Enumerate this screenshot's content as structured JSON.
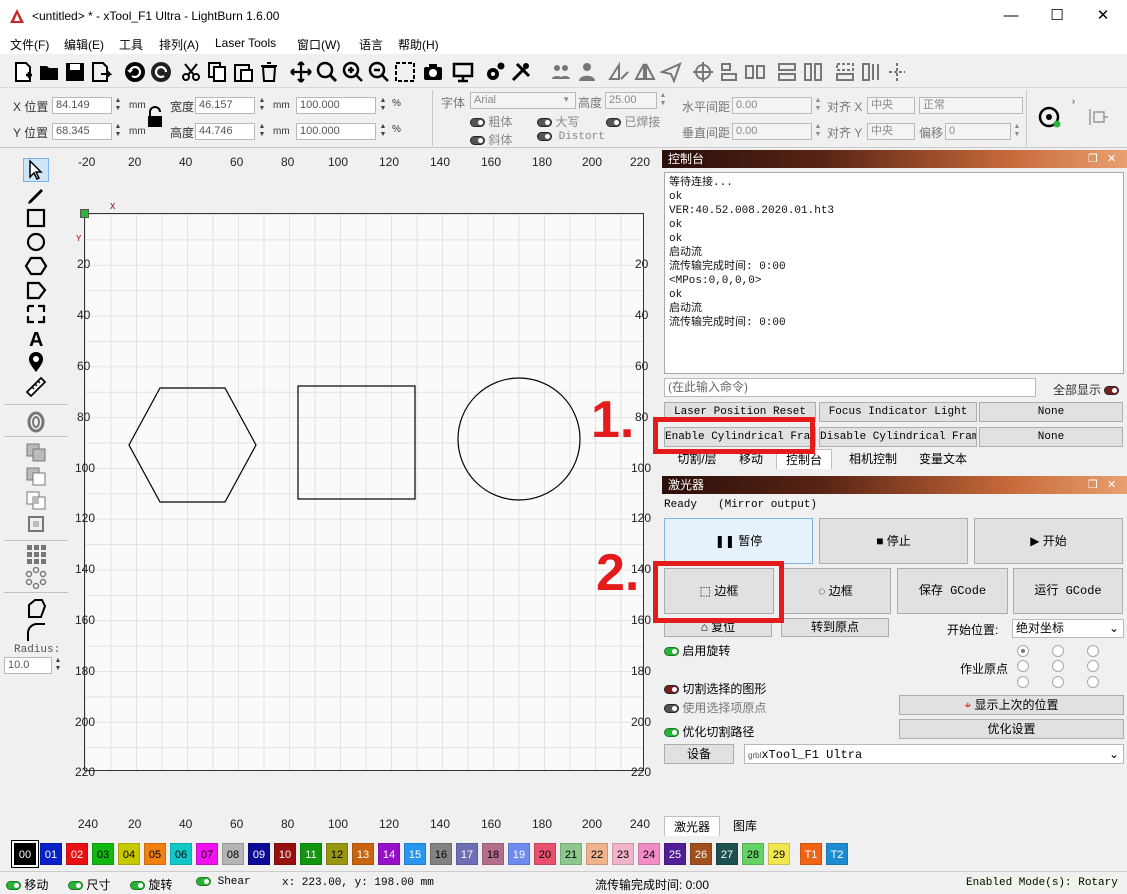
{
  "window": {
    "title": "<untitled> * - xTool_F1 Ultra - LightBurn 1.6.00",
    "minimize": "—",
    "maximize": "☐",
    "close": "✕"
  },
  "menu": [
    "文件(F)",
    "编辑(E)",
    "工具",
    "排列(A)",
    "Laser Tools",
    "窗口(W)",
    "语言",
    "帮助(H)"
  ],
  "props": {
    "x_label": "X 位置",
    "x_value": "84.149",
    "y_label": "Y 位置",
    "y_value": "68.345",
    "unit": "mm",
    "w_label": "宽度",
    "w_value": "46.157",
    "h_label": "高度",
    "h_value": "44.746",
    "pw_value": "100.000",
    "ph_value": "100.000",
    "pct": "%",
    "font_label": "字体",
    "font_value": "Arial",
    "height_label": "高度",
    "height_value": "25.00",
    "bold": "粗体",
    "upper": "大写",
    "welded": "已焊接",
    "italic": "斜体",
    "distort": "Distort",
    "hspace_label": "水平间距",
    "hspace_value": "0.00",
    "vspace_label": "垂直间距",
    "vspace_value": "0.00",
    "alignx_label": "对齐 X",
    "alignx_value": "中央",
    "aligny_label": "对齐 Y",
    "aligny_value": "中央",
    "normal_value": "正常",
    "offset_label": "偏移",
    "offset_value": "0"
  },
  "left": {
    "radius_label": "Radius:",
    "radius_value": "10.0"
  },
  "ruler": {
    "top": [
      "-20",
      "20",
      "40",
      "60",
      "80",
      "100",
      "120",
      "140",
      "160",
      "180",
      "200",
      "220"
    ],
    "side": [
      "20",
      "40",
      "60",
      "80",
      "100",
      "120",
      "140",
      "160",
      "180",
      "200",
      "220"
    ],
    "bottom": [
      "240",
      "20",
      "40",
      "60",
      "80",
      "100",
      "120",
      "140",
      "160",
      "180",
      "200",
      "240"
    ],
    "x_mark": "X",
    "y_mark": "Y"
  },
  "console": {
    "title": "控制台",
    "lines": [
      "等待连接...",
      "ok",
      "VER:40.52.008.2020.01.ht3",
      "ok",
      "ok",
      "启动流",
      "流传输完成时间: 0:00",
      "<MPos:0,0,0,0>",
      "ok",
      "",
      "启动流",
      "流传输完成时间: 0:00"
    ],
    "placeholder": "(在此输入命令)",
    "show_all": "全部显示",
    "macro1": "Laser Position Reset",
    "macro2": "Focus Indicator Light",
    "macro3": "None",
    "macro4": "Enable Cylindrical Frame",
    "macro5": "Disable Cylindrical Frame",
    "macro6": "None",
    "tabs": [
      "切割/层",
      "移动",
      "控制台",
      "相机控制",
      "变量文本"
    ]
  },
  "laser": {
    "title": "激光器",
    "status": "Ready",
    "mirror": "(Mirror output)",
    "pause": "暂停",
    "stop": "停止",
    "start": "开始",
    "frame1": "边框",
    "frame2": "边框",
    "save_gcode": "保存 GCode",
    "run_gcode": "运行 GCode",
    "home": "复位",
    "goto_origin": "转到原点",
    "start_from_label": "开始位置:",
    "start_from_value": "绝对坐标",
    "rotary": "启用旋转",
    "job_origin": "作业原点",
    "cut_selected": "切割选择的图形",
    "use_sel_origin": "使用选择项原点",
    "show_last": "显示上次的位置",
    "optimize": "优化切割路径",
    "opt_settings": "优化设置",
    "device_label": "设备",
    "device_value": "xTool_F1 Ultra",
    "grbl": "grbl",
    "bottom_tabs": [
      "激光器",
      "图库"
    ]
  },
  "annotations": {
    "n1": "1.",
    "n2": "2."
  },
  "palette": [
    "00",
    "01",
    "02",
    "03",
    "04",
    "05",
    "06",
    "07",
    "08",
    "09",
    "10",
    "11",
    "12",
    "13",
    "14",
    "15",
    "16",
    "17",
    "18",
    "19",
    "20",
    "21",
    "22",
    "23",
    "24",
    "25",
    "26",
    "27",
    "28",
    "29",
    "T1",
    "T2"
  ],
  "palette_colors": [
    "#000000",
    "#0a20c8",
    "#e81010",
    "#10b810",
    "#c8c800",
    "#f08010",
    "#10c8c8",
    "#f010f0",
    "#b4b4b4",
    "#0a0a96",
    "#961010",
    "#109610",
    "#969610",
    "#c86410",
    "#9610c8",
    "#2896f0",
    "#828282",
    "#6e6eb4",
    "#b46e8c",
    "#6e8cf0",
    "#e8506e",
    "#8cc88c",
    "#f0b48c",
    "#f0b4c8",
    "#f08cc8",
    "#501e96",
    "#a0501e",
    "#1e5050",
    "#64d264",
    "#f0e650",
    "#f06414",
    "#1e8cd2"
  ],
  "status": {
    "move": "移动",
    "size": "尺寸",
    "rotate": "旋转",
    "shear": "Shear",
    "coords": "x: 223.00, y: 198.00 mm",
    "stream": "流传输完成时间: 0:00",
    "mode": "Enabled Mode(s): Rotary"
  }
}
